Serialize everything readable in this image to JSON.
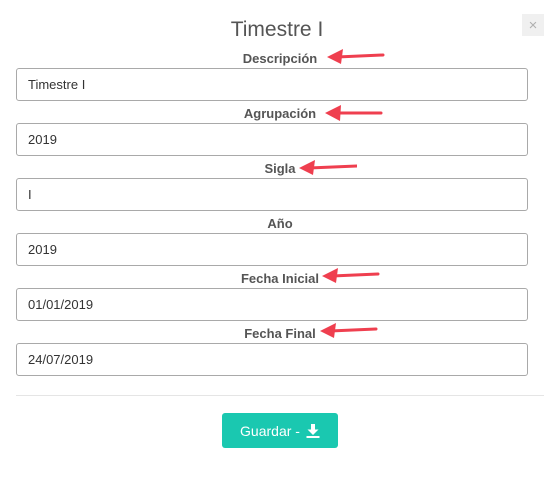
{
  "modal": {
    "title": "Timestre I",
    "close_label": "×"
  },
  "fields": [
    {
      "label": "Descripción",
      "value": "Timestre I"
    },
    {
      "label": "Agrupación",
      "value": "2019"
    },
    {
      "label": "Sigla",
      "value": "I"
    },
    {
      "label": "Año",
      "value": "2019"
    },
    {
      "label": "Fecha Inicial",
      "value": "01/01/2019"
    },
    {
      "label": "Fecha Final",
      "value": "24/07/2019"
    }
  ],
  "footer": {
    "save_label": "Guardar -"
  },
  "colors": {
    "accent": "#1ac8b0",
    "annotation_arrow": "#ef3f4f"
  }
}
